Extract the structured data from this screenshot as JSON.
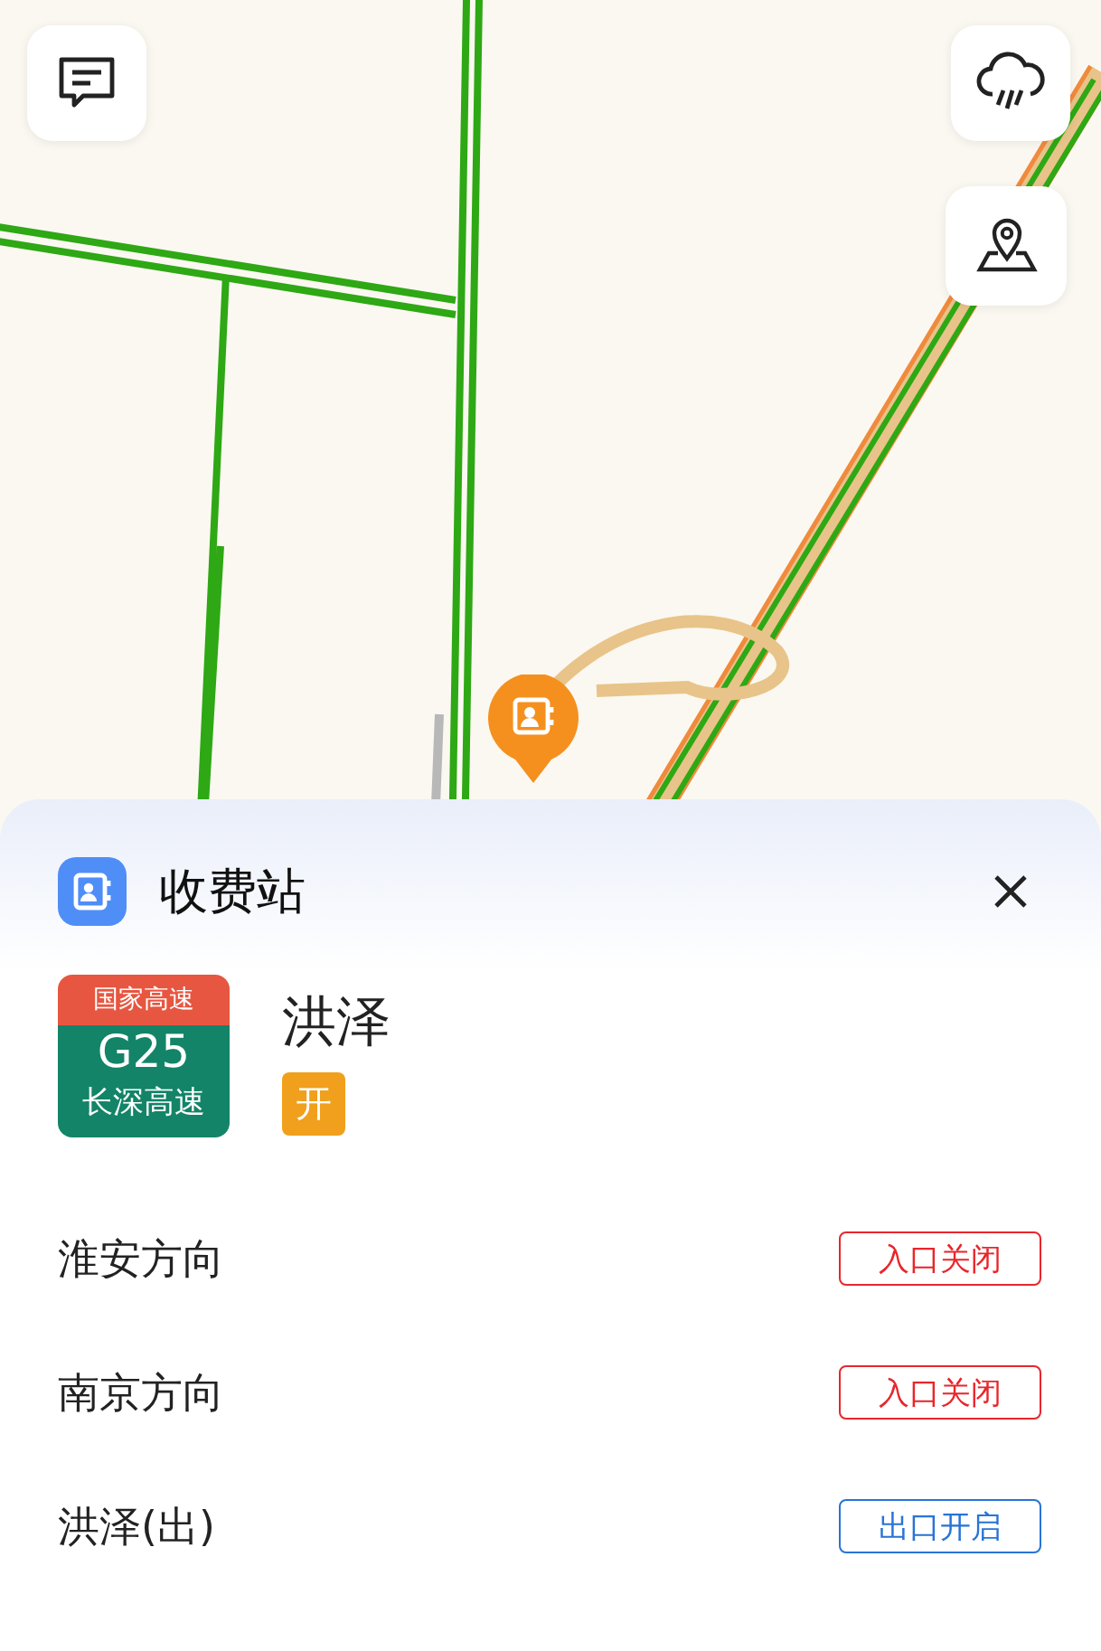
{
  "sheet": {
    "title": "收费站"
  },
  "highway": {
    "category": "国家高速",
    "code": "G25",
    "name": "长深高速"
  },
  "station": {
    "name": "洪泽",
    "tag": "开"
  },
  "directions": [
    {
      "name": "淮安方向",
      "status": "入口关闭",
      "open": false
    },
    {
      "name": "南京方向",
      "status": "入口关闭",
      "open": false
    },
    {
      "name": "洪泽(出)",
      "status": "出口开启",
      "open": true
    }
  ]
}
